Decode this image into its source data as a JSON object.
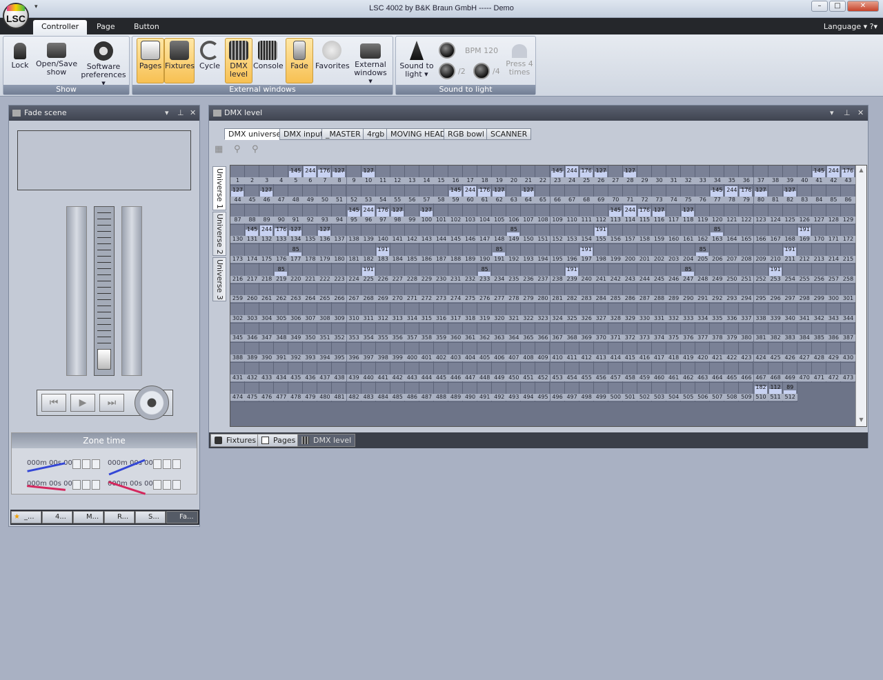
{
  "window": {
    "title": "LSC 4002     by B&K Braun GmbH ----- Demo",
    "minimize": "–",
    "maximize": "□",
    "close": "✕",
    "quick_access": "▾"
  },
  "logo": {
    "text": "LSC"
  },
  "ribbon_tabs": [
    "Controller",
    "Page",
    "Button"
  ],
  "language": "Language ▾ ?▾",
  "groups": {
    "show": {
      "label": "Show",
      "buttons": [
        "Lock",
        "Open/Save show",
        "Software preferences ▾"
      ]
    },
    "external": {
      "label": "External windows",
      "buttons": [
        "Pages",
        "Fixtures",
        "Cycle",
        "DMX level",
        "Console",
        "Fade",
        "Favorites",
        "External windows ▾"
      ]
    },
    "sound": {
      "label": "Sound to light",
      "sound_label": "Sound to light ▾",
      "bpm": "BPM 120",
      "div2": "/2",
      "div4": "/4",
      "press": "Press 4 times"
    }
  },
  "fade_panel": {
    "title": "Fade scene",
    "zone_title": "Zone time",
    "zones": [
      "000m 00s 00",
      "000m 00s 00",
      "000m 00s 00",
      "000m 00s 00"
    ],
    "tabs": [
      "_...",
      "4...",
      "M...",
      "R...",
      "S...",
      "Fa..."
    ]
  },
  "dmx_panel": {
    "title": "DMX level",
    "tabs": [
      "DMX universe",
      "DMX input",
      "_MASTER",
      "4rgb",
      "MOVING HEAD",
      "RGB bowl",
      "SCANNER"
    ],
    "universes": [
      "Universe 1",
      "Universe 2",
      "Universe 3"
    ],
    "bottom_tabs": [
      "Fixtures",
      "Pages",
      "DMX level"
    ],
    "channel_count": 512,
    "levels": {
      "5": 145,
      "6": 244,
      "7": 176,
      "8": 127,
      "10": 127,
      "23": 145,
      "24": 244,
      "25": 176,
      "26": 127,
      "28": 127,
      "41": 145,
      "42": 244,
      "43": 176,
      "44": 127,
      "46": 127,
      "59": 145,
      "60": 244,
      "61": 176,
      "62": 127,
      "64": 127,
      "77": 145,
      "78": 244,
      "79": 176,
      "80": 127,
      "82": 127,
      "95": 145,
      "96": 244,
      "97": 176,
      "98": 127,
      "100": 127,
      "113": 145,
      "114": 244,
      "115": 176,
      "116": 127,
      "118": 127,
      "131": 145,
      "132": 244,
      "133": 176,
      "134": 127,
      "136": 127,
      "149": 85,
      "155": 191,
      "163": 85,
      "169": 191,
      "177": 85,
      "183": 191,
      "191": 85,
      "197": 191,
      "205": 85,
      "211": 191,
      "219": 85,
      "225": 191,
      "233": 85,
      "239": 191,
      "247": 85,
      "253": 191,
      "510": 182,
      "511": 112,
      "512": 89
    }
  }
}
